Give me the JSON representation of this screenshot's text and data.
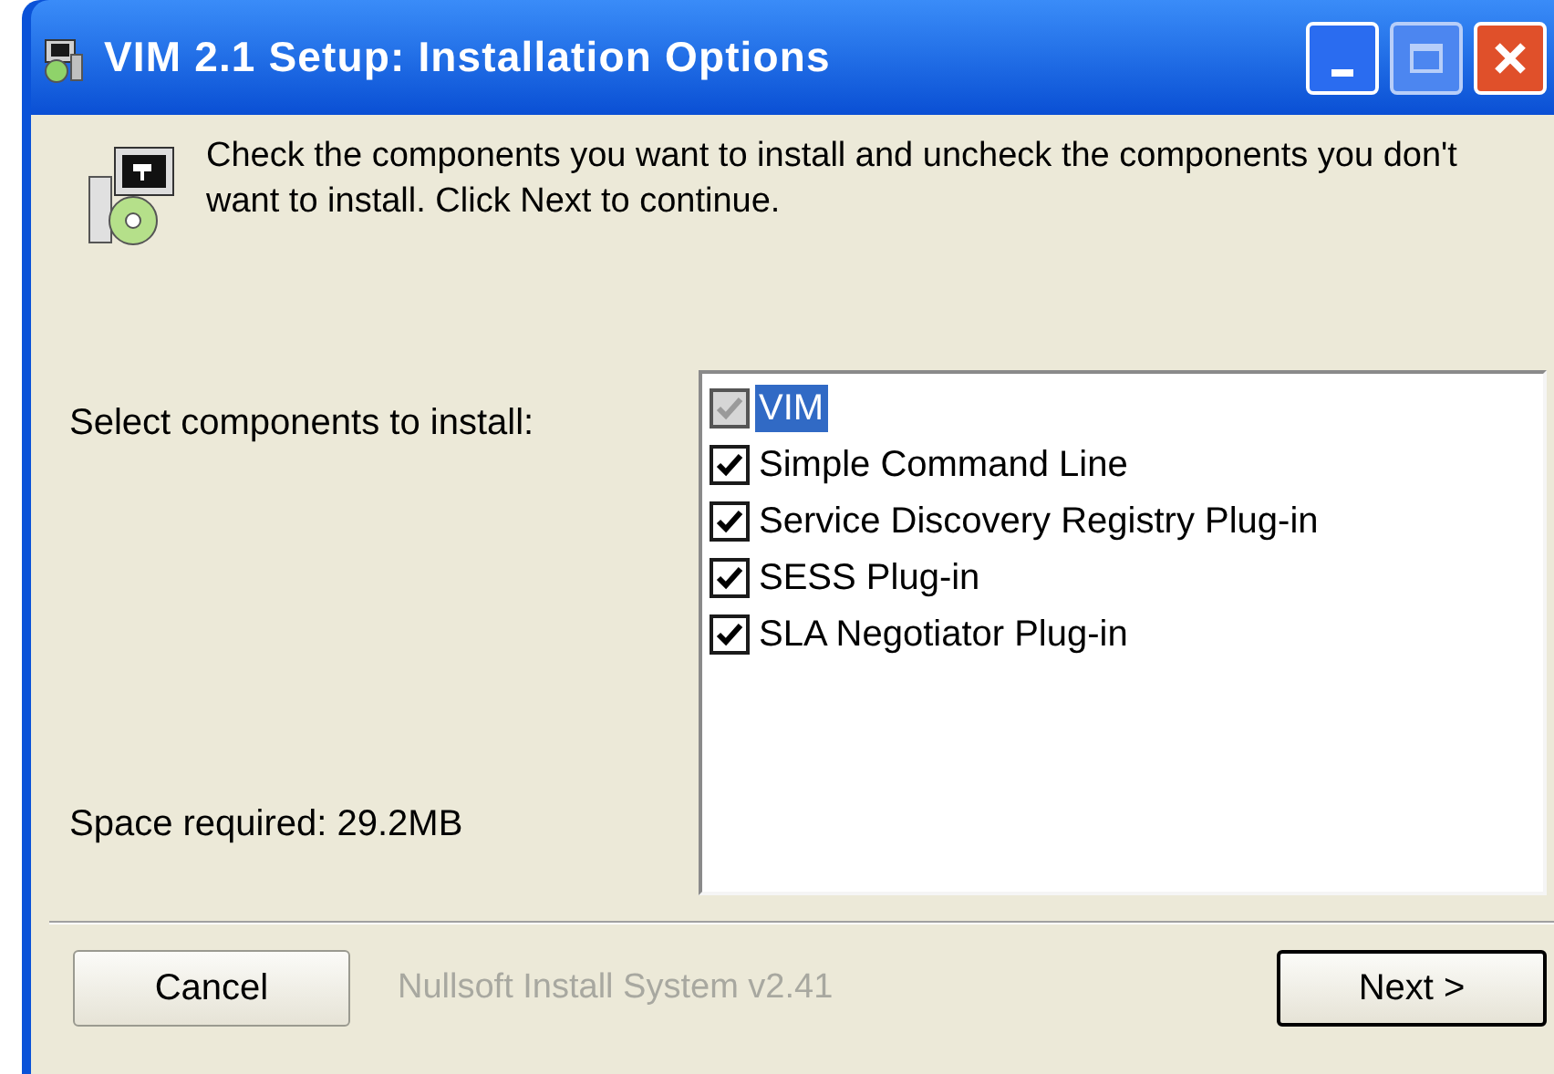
{
  "window": {
    "title": "VIM 2.1 Setup: Installation Options"
  },
  "header": {
    "text": "Check the components you want to install and uncheck the components you don't want to install. Click Next to continue."
  },
  "components_label": "Select components to install:",
  "components": [
    {
      "label": "VIM",
      "checked": true,
      "disabled": true,
      "selected": true
    },
    {
      "label": "Simple Command Line",
      "checked": true,
      "disabled": false,
      "selected": false
    },
    {
      "label": "Service Discovery Registry Plug-in",
      "checked": true,
      "disabled": false,
      "selected": false
    },
    {
      "label": "SESS Plug-in",
      "checked": true,
      "disabled": false,
      "selected": false
    },
    {
      "label": "SLA Negotiator Plug-in",
      "checked": true,
      "disabled": false,
      "selected": false
    }
  ],
  "space_required": "Space required: 29.2MB",
  "branding": "Nullsoft Install System v2.41",
  "buttons": [
    {
      "label": "Cancel",
      "default": false
    },
    {
      "label": "Next >",
      "default": true
    }
  ]
}
